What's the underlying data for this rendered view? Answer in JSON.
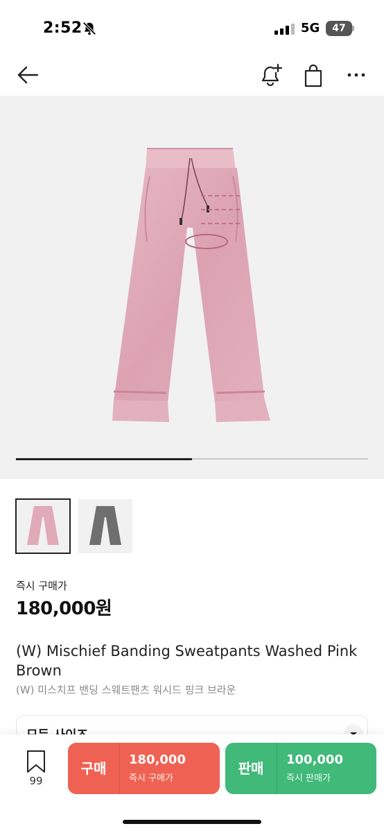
{
  "status_bar": {
    "time": "2:52",
    "network": "5G",
    "battery": "47"
  },
  "nav": {
    "back": "back-arrow-icon",
    "alert": "bell-plus-icon",
    "bag": "shopping-bag-icon",
    "more": "more-dots-icon"
  },
  "gallery": {
    "progress": 0.5,
    "bg_color": "#f1f1f1",
    "thumbnails": [
      "pink-brown",
      "gray"
    ]
  },
  "price": {
    "label": "즉시 구매가",
    "value": "180,000원"
  },
  "product": {
    "title_en": "(W) Mischief Banding Sweatpants Washed Pink Brown",
    "title_ko": "(W) 미스치프 밴딩 스웨트팬츠 워시드 핑크 브라운"
  },
  "size_select": {
    "label": "모든 사이즈"
  },
  "bottom_bar": {
    "wish_count": "99",
    "buy": {
      "kind": "구매",
      "amount": "180,000",
      "sub": "즉시 구매가",
      "color": "#ef6253"
    },
    "sell": {
      "kind": "판매",
      "amount": "100,000",
      "sub": "즉시 판매가",
      "color": "#41b979"
    }
  }
}
